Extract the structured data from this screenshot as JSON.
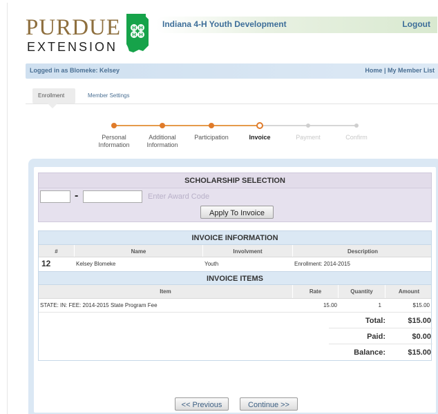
{
  "brand": {
    "name": "PURDUE",
    "sub": "EXTENSION",
    "colors": {
      "gold": "#8e6f3e",
      "clover": "#16a34a"
    }
  },
  "header": {
    "title": "Indiana 4-H Youth Development",
    "logout": "Logout"
  },
  "userbar": {
    "logged_in": "Logged in as Blomeke: Kelsey",
    "home": "Home",
    "separator": "|",
    "member_list": "My Member List"
  },
  "tabs": [
    {
      "label": "Enrollment",
      "active": true
    },
    {
      "label": "Member Settings",
      "active": false
    }
  ],
  "steps": [
    {
      "line1": "Personal",
      "line2": "Information",
      "state": "done"
    },
    {
      "line1": "Additional",
      "line2": "Information",
      "state": "done"
    },
    {
      "line1": "Participation",
      "line2": "",
      "state": "done"
    },
    {
      "line1": "Invoice",
      "line2": "",
      "state": "current"
    },
    {
      "line1": "Payment",
      "line2": "",
      "state": "future"
    },
    {
      "line1": "Confirm",
      "line2": "",
      "state": "future"
    }
  ],
  "scholarship": {
    "title": "SCHOLARSHIP SELECTION",
    "dash": "-",
    "code_hint": "Enter Award Code",
    "apply_button": "Apply To Invoice"
  },
  "invoice": {
    "title": "INVOICE INFORMATION",
    "headers": [
      "#",
      "Name",
      "Involvment",
      "Description"
    ],
    "row": {
      "num": "12",
      "name": "Kelsey Blomeke",
      "involvement": "Youth",
      "description": "Enrollment: 2014-2015"
    }
  },
  "items": {
    "title": "INVOICE ITEMS",
    "headers": [
      "Item",
      "Rate",
      "Quantity",
      "Amount"
    ],
    "rows": [
      {
        "item": "STATE: IN: FEE: 2014-2015 State Program Fee",
        "rate": "15.00",
        "quantity": "1",
        "amount": "$15.00"
      }
    ],
    "totals": [
      {
        "label": "Total:",
        "value": "$15.00"
      },
      {
        "label": "Paid:",
        "value": "$0.00"
      },
      {
        "label": "Balance:",
        "value": "$15.00"
      }
    ]
  },
  "nav": {
    "previous": "<< Previous",
    "continue": "Continue >>"
  }
}
